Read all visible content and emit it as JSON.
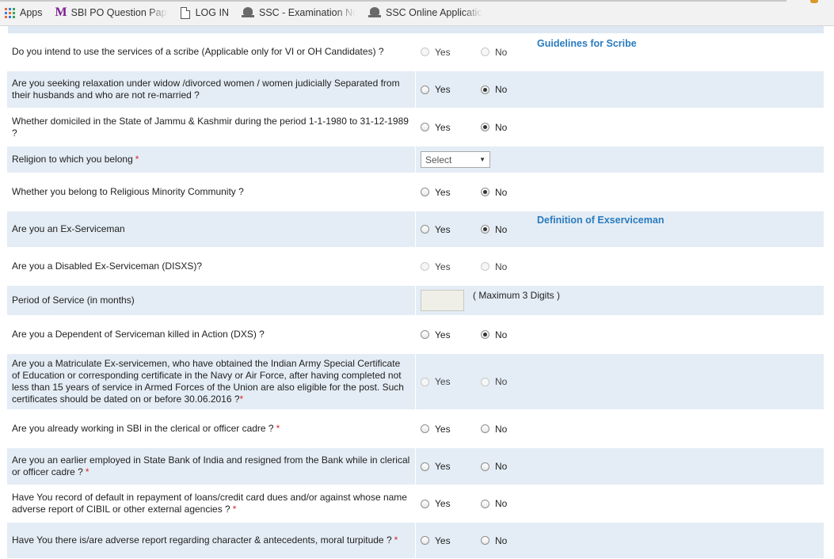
{
  "bookmarks": [
    {
      "icon": "apps-grid-icon",
      "label": "Apps"
    },
    {
      "icon": "m-logo-icon",
      "label": "SBI PO Question Pape"
    },
    {
      "icon": "page-icon",
      "label": "LOG IN"
    },
    {
      "icon": "emblem-icon",
      "label": "SSC - Examination No"
    },
    {
      "icon": "emblem-icon",
      "label": "SSC Online Applicatio"
    }
  ],
  "options": {
    "yes": "Yes",
    "no": "No"
  },
  "form": {
    "scribe": {
      "question": "Do you intend to use the services of a scribe (Applicable only for VI or OH Candidates) ?",
      "link": "Guidelines for Scribe"
    },
    "widow": {
      "question": "Are you seeking relaxation under widow /divorced women / women judicially Separated from their husbands and who are not re-married ?"
    },
    "jk": {
      "question": "Whether domiciled in the State of Jammu & Kashmir during the period 1-1-1980 to 31-12-1989 ?"
    },
    "religion": {
      "question": "Religion to which you belong",
      "select_value": "Select"
    },
    "minority": {
      "question": "Whether you belong to Religious Minority Community ?"
    },
    "exservice": {
      "question": "Are you an Ex-Serviceman",
      "link": "Definition of Exserviceman"
    },
    "disxs": {
      "question": "Are you a Disabled Ex-Serviceman (DISXS)?"
    },
    "period": {
      "question": "Period of Service (in months)",
      "note": "( Maximum 3 Digits )"
    },
    "dxs": {
      "question": "Are you a Dependent of Serviceman killed in Action (DXS) ?"
    },
    "matric": {
      "question": "Are you a Matriculate Ex-servicemen, who have obtained the Indian Army Special Certificate of Education or corresponding certificate in the Navy or Air Force, after having completed not less than 15 years of service in Armed Forces of the Union are also eligible for the post. Such certificates should be dated on or before 30.06.2016 ?"
    },
    "sbi_working": {
      "question": "Are you already working in SBI in the clerical or officer cadre ?"
    },
    "sbi_earlier": {
      "question": "Are you an earlier employed in State Bank of India and resigned from the Bank while in clerical or officer cadre ?"
    },
    "cibil": {
      "question": "Have You record of default in repayment of loans/credit card dues and/or against whose name adverse report of CIBIL or other external agencies ?"
    },
    "character": {
      "question": "Have You there is/are adverse report regarding character & antecedents, moral turpitude ?"
    }
  },
  "required_mark": "*"
}
